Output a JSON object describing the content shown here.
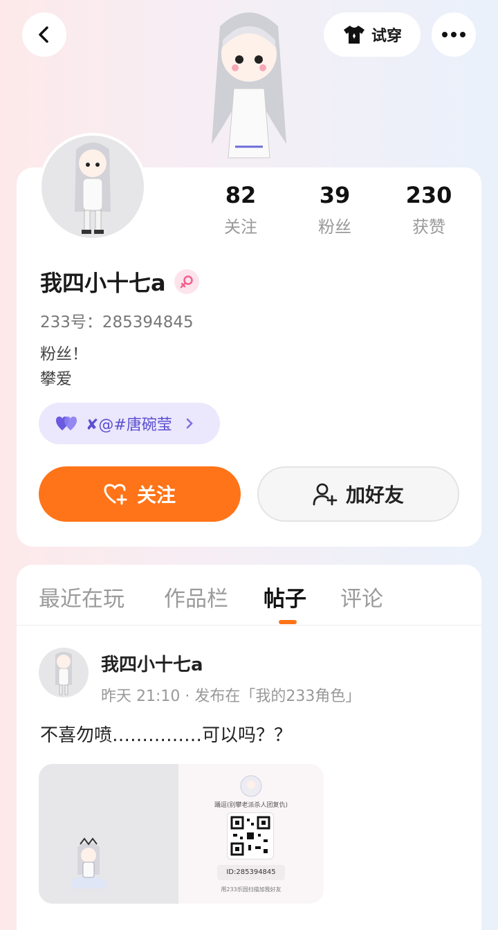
{
  "header": {
    "back_icon": "chevron-left-icon",
    "tryon_label": "试穿",
    "tryon_icon": "tshirt-icon",
    "more_icon": "more-dots-icon"
  },
  "profile": {
    "stats": [
      {
        "value": "82",
        "label": "关注"
      },
      {
        "value": "39",
        "label": "粉丝"
      },
      {
        "value": "230",
        "label": "获赞"
      }
    ],
    "username": "我四小十七a",
    "gender_icon": "female-icon",
    "uid_text": "233号：285394845",
    "bio_line1": "粉丝！",
    "bio_line2": "攀爱",
    "cp_tag_text": "✘@#唐碗莹",
    "follow_label": "关注",
    "add_friend_label": "加好友"
  },
  "tabs": [
    {
      "label": "最近在玩",
      "active": false
    },
    {
      "label": "作品栏",
      "active": false
    },
    {
      "label": "帖子",
      "active": true
    },
    {
      "label": "评论",
      "active": false
    }
  ],
  "post": {
    "author": "我四小十七a",
    "meta": "昨天 21:10 · 发布在「我的233角色」",
    "text": "不喜勿喷……………可以吗？？",
    "qr_title": "踊逗(别攀老派杀人团复仇)",
    "qr_id": "ID:285394845",
    "qr_hint": "用233乐园扫描加我好友"
  },
  "colors": {
    "accent": "#ff7418",
    "cp_tag_bg": "#ebe7fc",
    "cp_tag_text": "#5b4fd0"
  }
}
